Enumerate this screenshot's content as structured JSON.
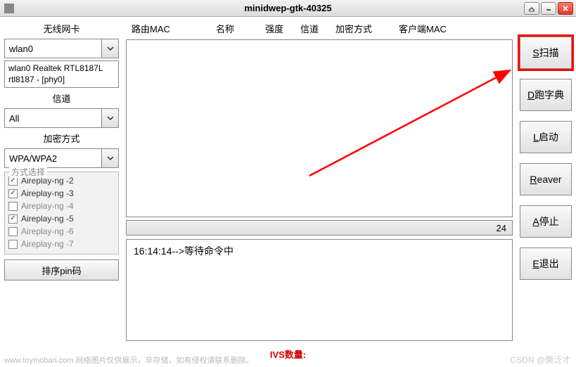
{
  "window": {
    "title": "minidwep-gtk-40325"
  },
  "left": {
    "wireless_label": "无线网卡",
    "wireless_value": "wlan0",
    "wireless_info": "wlan0 Realtek RTL8187L rtl8187 - [phy0]",
    "channel_label": "信道",
    "channel_value": "All",
    "encryption_label": "加密方式",
    "encryption_value": "WPA/WPA2",
    "method_legend": "方式选择",
    "methods": [
      {
        "label": "Aireplay-ng -2",
        "checked": true
      },
      {
        "label": "Aireplay-ng -3",
        "checked": true
      },
      {
        "label": "Aireplay-ng -4",
        "checked": false
      },
      {
        "label": "Aireplay-ng -5",
        "checked": true
      },
      {
        "label": "Aireplay-ng -6",
        "checked": false
      },
      {
        "label": "Aireplay-ng -7",
        "checked": false
      }
    ],
    "sort_btn": "排序pin码"
  },
  "center": {
    "headers": {
      "mac": "路由MAC",
      "name": "名称",
      "signal": "强度",
      "channel": "信道",
      "enc": "加密方式",
      "client": "客户端MAC"
    },
    "status_number": "24",
    "log_line": "16:14:14-->等待命令中"
  },
  "right": {
    "scan": {
      "u": "S",
      "rest": "扫描"
    },
    "dict": {
      "u": "D",
      "rest": "跑字典"
    },
    "launch": {
      "u": "L",
      "rest": "启动"
    },
    "reaver": {
      "u": "R",
      "rest": "eaver"
    },
    "stop": {
      "u": "A",
      "rest": "停止"
    },
    "exit": {
      "u": "E",
      "rest": "退出"
    }
  },
  "footer": {
    "ivs_label": "IVS数量:",
    "watermark": "www.toymoban.com 网络图片仅供展示，非存储，如有侵权请联系删除。",
    "csdn": "CSDN @懒泛才"
  }
}
